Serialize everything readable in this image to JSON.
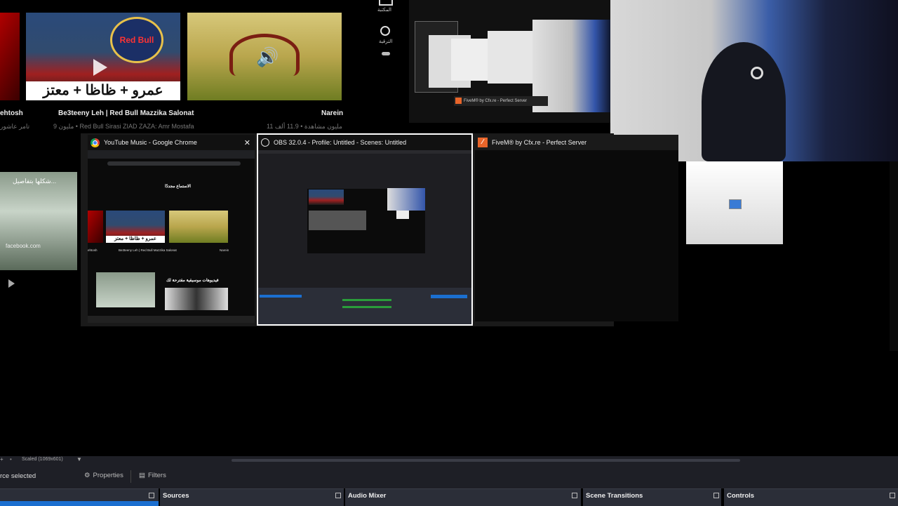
{
  "yt": {
    "row_titles": [
      "ehtosh",
      "Be3teeny Leh | Red Bull Mazzika Salonat",
      "Narein"
    ],
    "row_sub": [
      "تامر عاشور",
      "9 مليون • Red Bull Sirasi ZIAD ZAZA: Amr Mostafa",
      "11 مليون مشاهدة • 11.9 ألف"
    ],
    "side_labels": [
      "المكتبة",
      "الترقية"
    ],
    "banner_text": "عمرو + ظاظا + معتز",
    "redbull_text": "Red Bull",
    "left_card_title": "شكلها بتفاصيل...",
    "left_card_url": "facebook.com"
  },
  "alttab": {
    "windows": [
      {
        "title": "YouTube Music - Google Chrome",
        "close": "✕"
      },
      {
        "title": "OBS 32.0.4 - Profile: Untitled - Scenes: Untitled"
      },
      {
        "title": "FiveM® by Cfx.re - Perfect Server"
      }
    ],
    "chrome_thumb": {
      "heading": "الاستماع مجددًا",
      "video_title": "Be3teeny Leh | Red Bull Mazzika Salonat",
      "section": "فيديوهات موسيقية مقترحة لك",
      "left_title": "ehtosh",
      "right_title": "Narein"
    }
  },
  "nested": {
    "fivem_label": "FiveM® by Cfx.re - Perfect Server"
  },
  "obs": {
    "scaled_label": "Scaled (1069x601)",
    "no_source": "rce selected",
    "properties": "Properties",
    "filters": "Filters",
    "docks": [
      "Sources",
      "Audio Mixer",
      "Scene Transitions",
      "Controls"
    ]
  },
  "colors": {
    "obs_dock_bg": "#2b2e38",
    "accent": "#1b6fd0"
  }
}
